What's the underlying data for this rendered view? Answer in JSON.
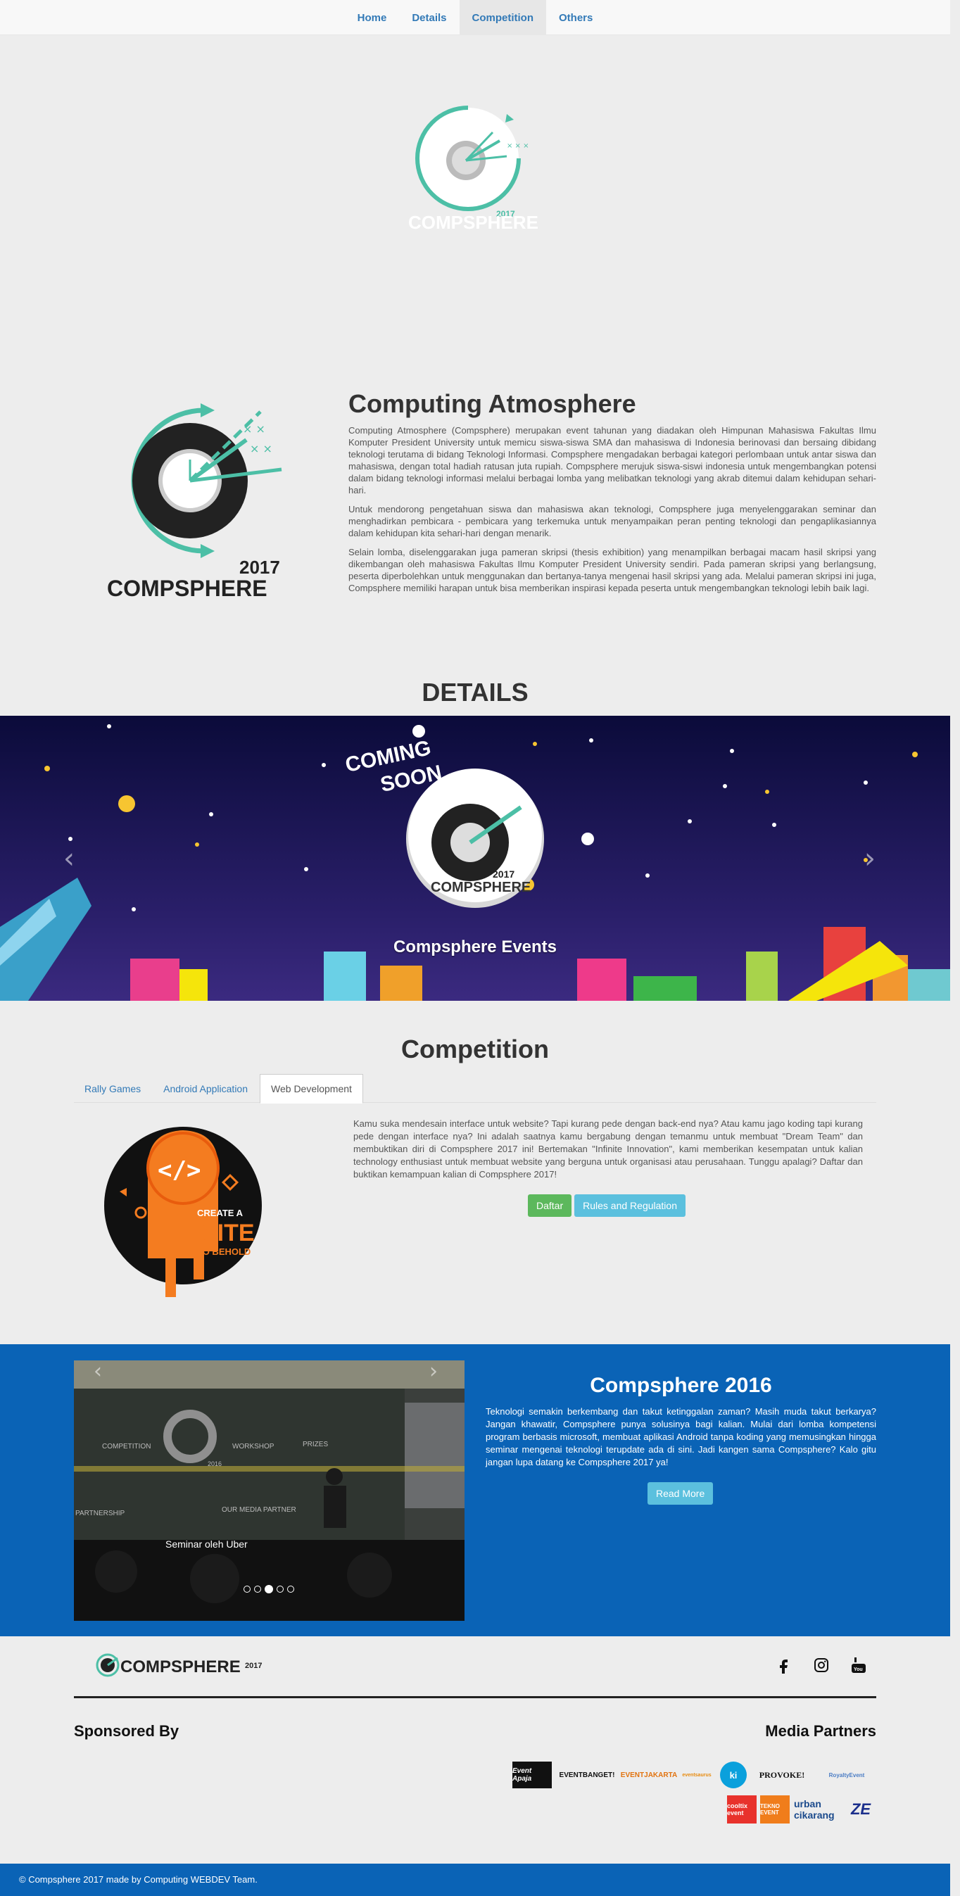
{
  "nav": {
    "items": [
      "Home",
      "Details",
      "Competition",
      "Others"
    ],
    "active": "Competition"
  },
  "logo": {
    "year": "2017",
    "brand": "COMPSPHERE"
  },
  "about": {
    "title": "Computing Atmosphere",
    "p1": "Computing Atmosphere (Compsphere) merupakan event tahunan yang diadakan oleh Himpunan Mahasiswa Fakultas Ilmu Komputer President University untuk memicu siswa-siswa SMA dan mahasiswa di Indonesia berinovasi dan bersaing dibidang teknologi terutama di bidang Teknologi Informasi. Compsphere mengadakan berbagai kategori perlombaan untuk antar siswa dan mahasiswa, dengan total hadiah ratusan juta rupiah. Compsphere merujuk siswa-siswi indonesia untuk mengembangkan potensi dalam bidang teknologi informasi melalui berbagai lomba yang melibatkan teknologi yang akrab ditemui dalam kehidupan sehari-hari.",
    "p2": "Untuk mendorong pengetahuan siswa dan mahasiswa akan teknologi, Compsphere juga menyelenggarakan seminar dan menghadirkan pembicara - pembicara yang terkemuka untuk menyampaikan peran penting teknologi dan pengaplikasiannya dalam kehidupan kita sehari-hari dengan menarik.",
    "p3": "Selain lomba, diselenggarakan juga pameran skripsi (thesis exhibition) yang menampilkan berbagai macam hasil skripsi yang dikembangan oleh mahasiswa Fakultas Ilmu Komputer President University sendiri. Pada pameran skripsi yang berlangsung, peserta diperbolehkan untuk menggunakan dan bertanya-tanya mengenai hasil skripsi yang ada. Melalui pameran skripsi ini juga, Compsphere memiliki harapan untuk bisa memberikan inspirasi kepada peserta untuk mengembangkan teknologi lebih baik lagi."
  },
  "details": {
    "title": "DETAILS",
    "banner_top": "COMING",
    "banner_top2": "SOON",
    "banner_caption": "Compsphere Events",
    "prev": "‹",
    "next": "›"
  },
  "competition": {
    "title": "Competition",
    "tabs": [
      "Rally Games",
      "Android Application",
      "Web Development"
    ],
    "active_tab": "Web Development",
    "image_text1": "CREATE A",
    "image_text2": "SITE",
    "image_text3": "TO BEHOLD",
    "description": "Kamu suka mendesain interface untuk website? Tapi kurang pede dengan back-end nya? Atau kamu jago koding tapi kurang pede dengan interface nya? Ini adalah saatnya kamu bergabung dengan temanmu untuk membuat \"Dream Team\" dan membuktikan diri di Compsphere 2017 ini! Bertemakan \"Infinite Innovation\", kami memberikan kesempatan untuk kalian technology enthusiast untuk membuat website yang berguna untuk organisasi atau perusahaan. Tunggu apalagi? Daftar dan buktikan kemampuan kalian di Compsphere 2017!",
    "register_label": "Daftar",
    "rules_label": "Rules and Regulation"
  },
  "history": {
    "title": "Compsphere 2016",
    "text": "Teknologi semakin berkembang dan takut ketinggalan zaman? Masih muda takut berkarya? Jangan khawatir, Compsphere punya solusinya bagi kalian. Mulai dari lomba kompetensi program berbasis microsoft, membuat aplikasi Android tanpa koding yang memusingkan hingga seminar mengenai teknologi terupdate ada di sini. Jadi kangen sama Compsphere? Kalo gitu jangan lupa datang ke Compsphere 2017 ya!",
    "read_more": "Read More",
    "photo_caption": "Seminar oleh Uber",
    "slides_total": 5,
    "slide_active": 3,
    "photo_signs": [
      "COMPETITION",
      "WORKSHOP",
      "PRIZES",
      "PARTNERSHIP",
      "OUR MEDIA PARTNER",
      "2016"
    ]
  },
  "footer": {
    "brand": "COMPSPHERE",
    "year": "2017",
    "sponsored": "Sponsored By",
    "media_partners": "Media Partners",
    "partners": [
      "Event Apaja",
      "EVENTBANGET!",
      "EVENTJAKARTA",
      "eventsaurus",
      "ki",
      "PROVOKE!",
      "RoyaltyEvent",
      "cooltix event",
      "TEKNO EVENT",
      "urban cikarang",
      "ZE"
    ],
    "copyright": "© Compsphere 2017 made by Computing WEBDEV Team.",
    "social_icons": [
      "facebook-icon",
      "instagram-icon",
      "youtube-icon"
    ]
  }
}
